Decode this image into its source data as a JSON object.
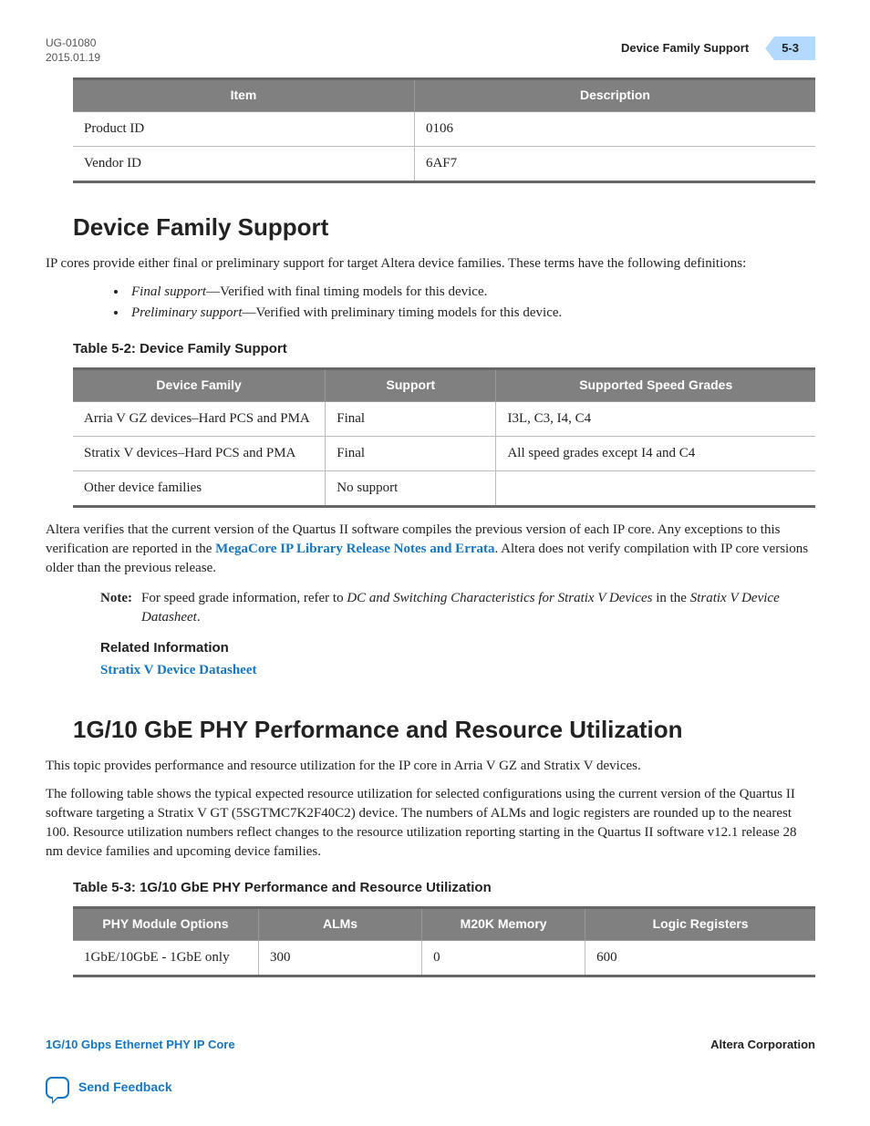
{
  "header": {
    "doc_id": "UG-01080",
    "date": "2015.01.19",
    "section_ref": "Device Family Support",
    "page_badge": "5-3"
  },
  "table1": {
    "headers": [
      "Item",
      "Description"
    ],
    "rows": [
      [
        "Product ID",
        "0106"
      ],
      [
        "Vendor ID",
        "6AF7"
      ]
    ]
  },
  "section1": {
    "heading": "Device Family Support",
    "intro": "IP cores provide either final or preliminary support for target Altera device families. These terms have the following definitions:",
    "bullets": [
      {
        "term": "Final support",
        "desc": "—Verified with final timing models for this device."
      },
      {
        "term": "Preliminary support",
        "desc": "—Verified with preliminary timing models for this device."
      }
    ],
    "table_caption": "Table 5-2: Device Family Support",
    "table": {
      "headers": [
        "Device Family",
        "Support",
        "Supported Speed Grades"
      ],
      "rows": [
        [
          "Arria V GZ devices–Hard PCS and PMA",
          "Final",
          "I3L, C3, I4, C4"
        ],
        [
          "Stratix V devices–Hard PCS and PMA",
          "Final",
          "All speed grades except I4 and C4"
        ],
        [
          "Other device families",
          "No support",
          ""
        ]
      ]
    },
    "para2_a": "Altera verifies that the current version of the Quartus II software compiles the previous version of each IP core. Any exceptions to this verification are reported in the ",
    "para2_link": "MegaCore IP Library Release Notes and Errata",
    "para2_b": ". Altera does not verify compilation with IP core versions older than the previous release.",
    "note_label": "Note:",
    "note_a": "For speed grade information, refer to ",
    "note_italic": "DC and Switching Characteristics for Stratix V Devices",
    "note_b": " in the ",
    "note_italic2": "Stratix V Device Datasheet",
    "note_c": ".",
    "related_heading": "Related Information",
    "related_link": "Stratix V Device Datasheet"
  },
  "section2": {
    "heading": "1G/10 GbE PHY Performance and Resource Utilization",
    "para1": "This topic provides performance and resource utilization for the IP core in Arria V GZ and Stratix V devices.",
    "para2": "The following table shows the typical expected resource utilization for selected configurations using the current version of the Quartus II software targeting a Stratix V GT (5SGTMC7K2F40C2) device. The numbers of ALMs and logic registers are rounded up to the nearest 100. Resource utilization numbers reflect changes to the resource utilization reporting starting in the Quartus II software v12.1 release 28 nm device families and upcoming device families.",
    "table_caption": "Table 5-3: 1G/10 GbE PHY Performance and Resource Utilization",
    "table": {
      "headers": [
        "PHY Module Options",
        "ALMs",
        "M20K Memory",
        "Logic Registers"
      ],
      "rows": [
        [
          "1GbE/10GbE - 1GbE only",
          "300",
          "0",
          "600"
        ]
      ]
    }
  },
  "footer": {
    "left": "1G/10 Gbps Ethernet PHY IP Core",
    "right": "Altera Corporation",
    "feedback": "Send Feedback"
  }
}
